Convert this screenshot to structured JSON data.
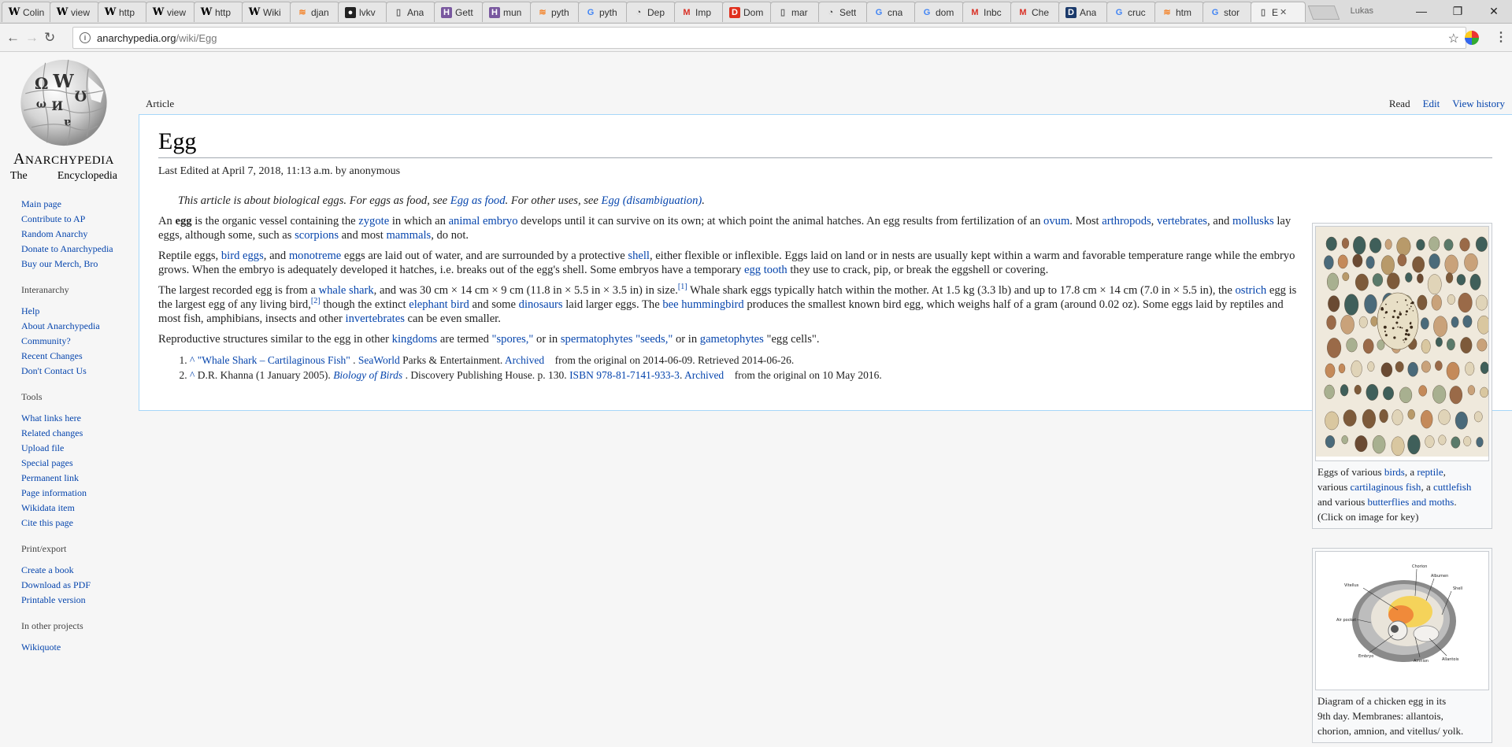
{
  "browser": {
    "tabs": [
      {
        "title": "Colin",
        "icon": "W"
      },
      {
        "title": "view",
        "icon": "W"
      },
      {
        "title": "http",
        "icon": "W"
      },
      {
        "title": "view",
        "icon": "W"
      },
      {
        "title": "http",
        "icon": "W"
      },
      {
        "title": "Wiki",
        "icon": "W"
      },
      {
        "title": "djan",
        "icon": "stackoverflow"
      },
      {
        "title": "lvkv",
        "icon": "github"
      },
      {
        "title": "Ana",
        "icon": "page"
      },
      {
        "title": "Gett",
        "icon": "heroku"
      },
      {
        "title": "mun",
        "icon": "heroku"
      },
      {
        "title": "pyth",
        "icon": "stackoverflow"
      },
      {
        "title": "pyth",
        "icon": "google"
      },
      {
        "title": "Dep",
        "icon": "dep"
      },
      {
        "title": "Imp",
        "icon": "gmail"
      },
      {
        "title": "Dom",
        "icon": "red-circle"
      },
      {
        "title": "mar",
        "icon": "page"
      },
      {
        "title": "Sett",
        "icon": "dep"
      },
      {
        "title": "cna",
        "icon": "google"
      },
      {
        "title": "dom",
        "icon": "google"
      },
      {
        "title": "Inbc",
        "icon": "gmail"
      },
      {
        "title": "Che",
        "icon": "gmail"
      },
      {
        "title": "Ana",
        "icon": "d-circle"
      },
      {
        "title": "cruc",
        "icon": "google"
      },
      {
        "title": "htm",
        "icon": "stackoverflow"
      },
      {
        "title": "stor",
        "icon": "google"
      },
      {
        "title": "E",
        "icon": "page",
        "active": true
      }
    ],
    "profile_name": "Lukas",
    "url_domain": "anarchypedia.org",
    "url_path": "/wiki/Egg"
  },
  "site": {
    "name_first": "A",
    "name_rest": "NARCHYPEDIA",
    "tagline_left": "The",
    "tagline_right": "Encyclopedia"
  },
  "sidebar": {
    "navigation": [
      "Main page",
      "Contribute to AP",
      "Random Anarchy",
      "Donate to Anarchypedia",
      "Buy our Merch, Bro"
    ],
    "interanarchy": {
      "heading": "Interanarchy",
      "items": [
        "Help",
        "About Anarchypedia",
        "Community?",
        "Recent Changes",
        "Don't Contact Us"
      ]
    },
    "tools": {
      "heading": "Tools",
      "items": [
        "What links here",
        "Related changes",
        "Upload file",
        "Special pages",
        "Permanent link",
        "Page information",
        "Wikidata item",
        "Cite this page"
      ]
    },
    "print": {
      "heading": "Print/export",
      "items": [
        "Create a book",
        "Download as PDF",
        "Printable version"
      ]
    },
    "other": {
      "heading": "In other projects",
      "items": [
        "Wikiquote"
      ]
    }
  },
  "tabs": {
    "article": "Article",
    "read": "Read",
    "edit": "Edit",
    "history": "View history"
  },
  "article": {
    "title": "Egg",
    "last_edited": "Last Edited at April 7, 2018, 11:13 a.m. by anonymous",
    "hatnote": {
      "t1": "This article is about biological eggs. For eggs as food, see ",
      "l1": "Egg as food",
      "t2": ". For other uses, see ",
      "l2": "Egg (disambiguation)",
      "t3": "."
    },
    "p1": {
      "t0": "An ",
      "b0": "egg",
      "t1": " is the organic vessel containing the ",
      "l1": "zygote",
      "t2": " in which an ",
      "l2": "animal embryo",
      "t3": " develops until it can survive on its own; at which point the animal hatches. An egg results from fertilization of an ",
      "l3": "ovum",
      "t4": ". Most ",
      "l4": "arthropods",
      "t5": ", ",
      "l5": "vertebrates",
      "t6": ", and ",
      "l6": "mollusks",
      "t7": " lay eggs, although some, such as ",
      "l7": "scorpions",
      "t8": " and most ",
      "l8": "mammals",
      "t9": ", do not."
    },
    "p2": {
      "t0": "Reptile eggs, ",
      "l1": "bird eggs",
      "t1": ", and ",
      "l2": "monotreme",
      "t2": " eggs are laid out of water, and are surrounded by a protective ",
      "l3": "shell",
      "t3": ", either flexible or inflexible. Eggs laid on land or in nests are usually kept within a warm and favorable temperature range while the embryo grows. When the embryo is adequately developed it hatches, i.e. breaks out of the egg's shell. Some embryos have a temporary ",
      "l4": "egg tooth",
      "t4": " they use to crack, pip, or break the eggshell or covering."
    },
    "p3": {
      "t0": "The largest recorded egg is from a ",
      "l1": "whale shark",
      "t1": ", and was 30 cm × 14 cm × 9 cm (11.8 in × 5.5 in × 3.5 in) in size.",
      "s1": "[1]",
      "t2": " Whale shark eggs typically hatch within the mother. At 1.5 kg (3.3 lb) and up to 17.8 cm × 14 cm (7.0 in × 5.5 in), the ",
      "l2": "ostrich",
      "t3": " egg is the largest egg of any living bird,",
      "s2": "[2]",
      "t4": " though the extinct ",
      "l3": "elephant bird",
      "t5": " and some ",
      "l4": "dinosaurs",
      "t6": " laid larger eggs. The ",
      "l5": "bee hummingbird",
      "t7": " produces the smallest known bird egg, which weighs half of a gram (around 0.02 oz). Some eggs laid by reptiles and most fish, amphibians, insects and other ",
      "l6": "invertebrates",
      "t8": " can be even smaller."
    },
    "p4": {
      "t0": "Reproductive structures similar to the egg in other ",
      "l1": "kingdoms",
      "t1": " are termed ",
      "l2": "\"spores,\"",
      "t2": " or in ",
      "l3": "spermatophytes",
      "t3": " ",
      "l4": "\"seeds,\"",
      "t4": " or in ",
      "l5": "gametophytes",
      "t5": " \"egg cells\"."
    },
    "refs": [
      {
        "caret": "^",
        "l1": "\"Whale Shark – Cartilaginous Fish\"",
        "t1": " . ",
        "l2": "SeaWorld",
        "t2": " Parks & Entertainment. ",
        "l3": "Archived",
        "t3": "    from the original on 2014-06-09. Retrieved 2014-06-26."
      },
      {
        "caret": "^",
        "t0": "D.R. Khanna (1 January 2005). ",
        "l1": "Biology of Birds",
        "t1": " . Discovery Publishing House. p. 130. ",
        "l2": "ISBN 978-81-7141-933-3",
        "t2": ". ",
        "l3": "Archived",
        "t3": "    from the original on 10 May 2016."
      }
    ]
  },
  "figure1": {
    "c0": "Eggs of various ",
    "l1": "birds",
    "c1": ", a ",
    "l2": "reptile",
    "c2": ",",
    "c3": "various ",
    "l3": "cartilaginous fish",
    "c4": ", a ",
    "l4": "cuttlefish",
    "c5": "and various ",
    "l5": "butterflies and moths",
    "c6": ".",
    "c7": "(Click on image for key)"
  },
  "figure2": {
    "labels": {
      "chorion": "Chorion",
      "albumen": "Albumen",
      "vitellus": "Vitellus",
      "shell": "Shell",
      "air": "Air pocket",
      "embryo": "Embryo",
      "amnion": "Amnion",
      "allantois": "Allantois"
    },
    "cap1": "Diagram of a chicken egg in its",
    "cap2": "9th day. Membranes: allantois,",
    "cap3": "chorion, amnion, and vitellus/ yolk."
  }
}
